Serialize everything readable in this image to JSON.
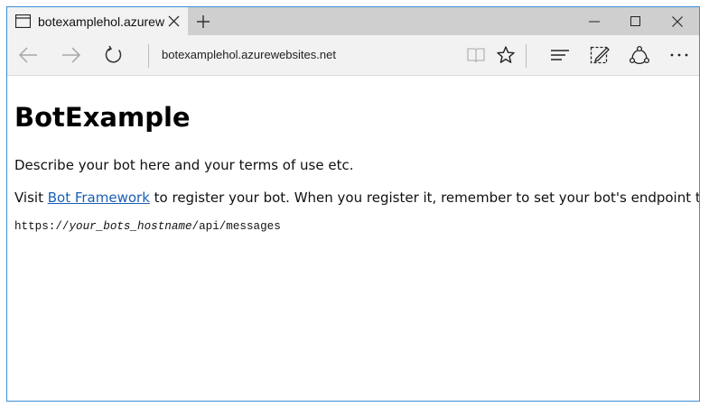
{
  "tab": {
    "title": "botexamplehol.azurewe"
  },
  "address_bar": {
    "url": "botexamplehol.azurewebsites.net"
  },
  "page": {
    "title": "BotExample",
    "description": "Describe your bot here and your terms of use etc.",
    "register_prefix": "Visit ",
    "register_link": "Bot Framework",
    "register_suffix": " to register your bot. When you register it, remember to set your bot's endpoint to",
    "endpoint": {
      "scheme": "https://",
      "hostname": "your_bots_hostname",
      "path": "/api/messages"
    }
  },
  "icons": {
    "tab": "page-icon",
    "close": "close-icon",
    "new_tab": "plus-icon",
    "back": "arrow-left-icon",
    "forward": "arrow-right-icon",
    "refresh": "refresh-icon",
    "reading_view": "book-icon",
    "favorite": "star-icon",
    "hub": "hub-icon",
    "web_note": "pen-note-icon",
    "share": "share-icon",
    "more": "ellipsis-icon"
  },
  "colors": {
    "window_border": "#3c8fd6",
    "link": "#1a5fb4",
    "titlebar": "#cfcfcf",
    "toolbar": "#f2f2f2"
  }
}
